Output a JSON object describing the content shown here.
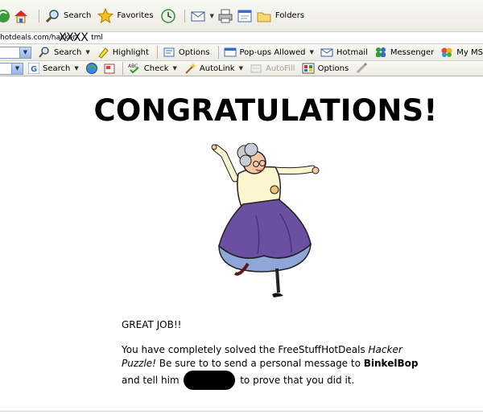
{
  "std_toolbar": {
    "search_label": "Search",
    "favorites_label": "Favorites",
    "folders_label": "Folders"
  },
  "address": {
    "url": "hotdeals.com/hacker/",
    "url_suffix": "tml",
    "overlay": "XXXX"
  },
  "msn_toolbar": {
    "search_label": "Search",
    "highlight_label": "Highlight",
    "options_label": "Options",
    "popups_label": "Pop-ups Allowed",
    "hotmail_label": "Hotmail",
    "messenger_label": "Messenger",
    "mymsn_label": "My MSN"
  },
  "google_toolbar": {
    "search_label": "Search",
    "check_label": "Check",
    "autolink_label": "AutoLink",
    "autofill_label": "AutoFill",
    "options_label": "Options"
  },
  "page": {
    "heading": "CONGRATULATIONS!",
    "great_job": "GREAT JOB!!",
    "line1_pre": "You have completely solved the FreeStuffHotDeals ",
    "line1_em": "Hacker Puzzle!",
    "line1_post": " Be sure to to send a personal message to ",
    "recipient": "BinkelBop",
    "line2_pre": "and tell him ",
    "line2_post": " to prove that you did it."
  },
  "colors": {
    "dress": "#6b4fa0",
    "petticoat": "#8fa6d8",
    "blouse": "#fbf5d0"
  }
}
